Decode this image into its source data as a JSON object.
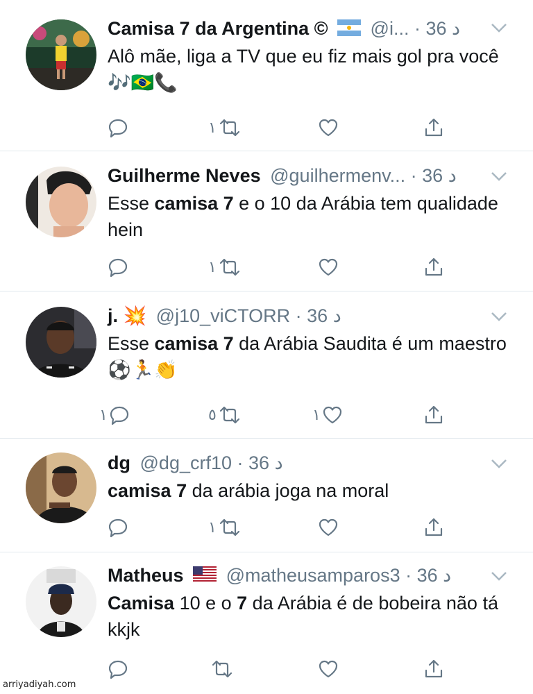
{
  "tweets": [
    {
      "name": "Camisa 7 da Argentina",
      "name_suffix": "©",
      "handle": "@i...",
      "time": "· د 36",
      "text_parts": [
        {
          "t": "Alô mãe, liga a TV que eu fiz mais gol pra você ",
          "b": false
        }
      ],
      "emoji_tail": "🎶🇧🇷📞",
      "flag": "argentina",
      "reply_count": "",
      "retweet_count": "١",
      "like_count": ""
    },
    {
      "name": "Guilherme Neves",
      "handle": "@guilhermenv...",
      "time": "· د 36",
      "text_parts": [
        {
          "t": "Esse ",
          "b": false
        },
        {
          "t": "camisa 7",
          "b": true
        },
        {
          "t": " e o 10 da Arábia tem qualidade hein",
          "b": false
        }
      ],
      "reply_count": "",
      "retweet_count": "١",
      "like_count": ""
    },
    {
      "name": "j.",
      "handle": "@j10_viCTORR",
      "time": "· د 36",
      "name_emoji": "💥",
      "text_parts": [
        {
          "t": "Esse ",
          "b": false
        },
        {
          "t": "camisa 7",
          "b": true
        },
        {
          "t": " da Arábia Saudita é um maestro ",
          "b": false
        }
      ],
      "emoji_tail": "⚽🏃👏",
      "reply_count": "١",
      "retweet_count": "٥",
      "like_count": "١"
    },
    {
      "name": "dg",
      "handle": "@dg_crf10",
      "time": "· د 36",
      "text_parts": [
        {
          "t": "camisa 7",
          "b": true
        },
        {
          "t": " da arábia joga na moral",
          "b": false
        }
      ],
      "reply_count": "",
      "retweet_count": "١",
      "like_count": ""
    },
    {
      "name": "Matheus",
      "handle": "@matheusamparos3",
      "time": "· د 36",
      "flag": "usa",
      "text_parts": [
        {
          "t": "Camisa",
          "b": true
        },
        {
          "t": " 10 e o  ",
          "b": false
        },
        {
          "t": "7",
          "b": true
        },
        {
          "t": " da Arábia é de bobeira não tá kkjk",
          "b": false
        }
      ],
      "reply_count": "",
      "retweet_count": "",
      "like_count": ""
    }
  ],
  "watermark": "arriyadiyah.com",
  "colors": {
    "text": "#14171a",
    "muted": "#657786",
    "divider": "#e1e8ed",
    "chevron": "#aab8c2"
  }
}
